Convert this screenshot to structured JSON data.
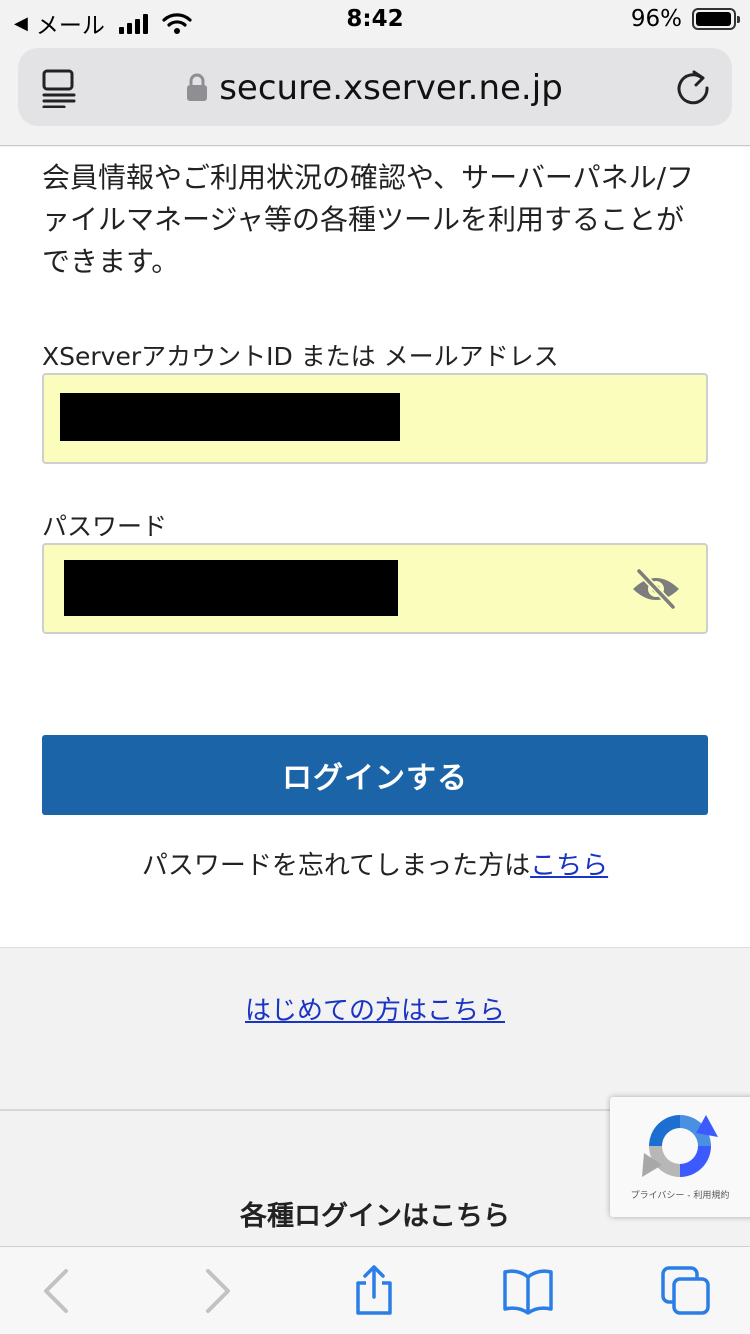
{
  "status_bar": {
    "back_app": "メール",
    "time": "8:42",
    "battery": "96%",
    "battery_level": 0.96
  },
  "browser": {
    "url": "secure.xserver.ne.jp"
  },
  "login": {
    "intro": "会員情報やご利用状況の確認や、サーバーパネル/ファイルマネージャ等の各種ツールを利用することができます。",
    "account_label": "XServerアカウントID または メールアドレス",
    "password_label": "パスワード",
    "submit_label": "ログインする",
    "forgot_prefix": "パスワードを忘れてしまった方は",
    "forgot_link": "こちら"
  },
  "first_time_link": "はじめての方はこちら",
  "various_login_heading": "各種ログインはこちら",
  "recaptcha": {
    "footer": "プライバシー - 利用規約"
  },
  "icons": {
    "reader": "reader-icon",
    "lock": "lock-icon",
    "reload": "reload-icon",
    "eye_off": "eye-off-icon",
    "back": "chevron-left-icon",
    "forward": "chevron-right-icon",
    "share": "share-icon",
    "bookmarks": "book-icon",
    "tabs": "tabs-icon"
  },
  "colors": {
    "button": "#1c64a8",
    "link": "#1a34c4",
    "autofill": "#fafdbb",
    "toolbar_icons": "#2a7ee6"
  }
}
